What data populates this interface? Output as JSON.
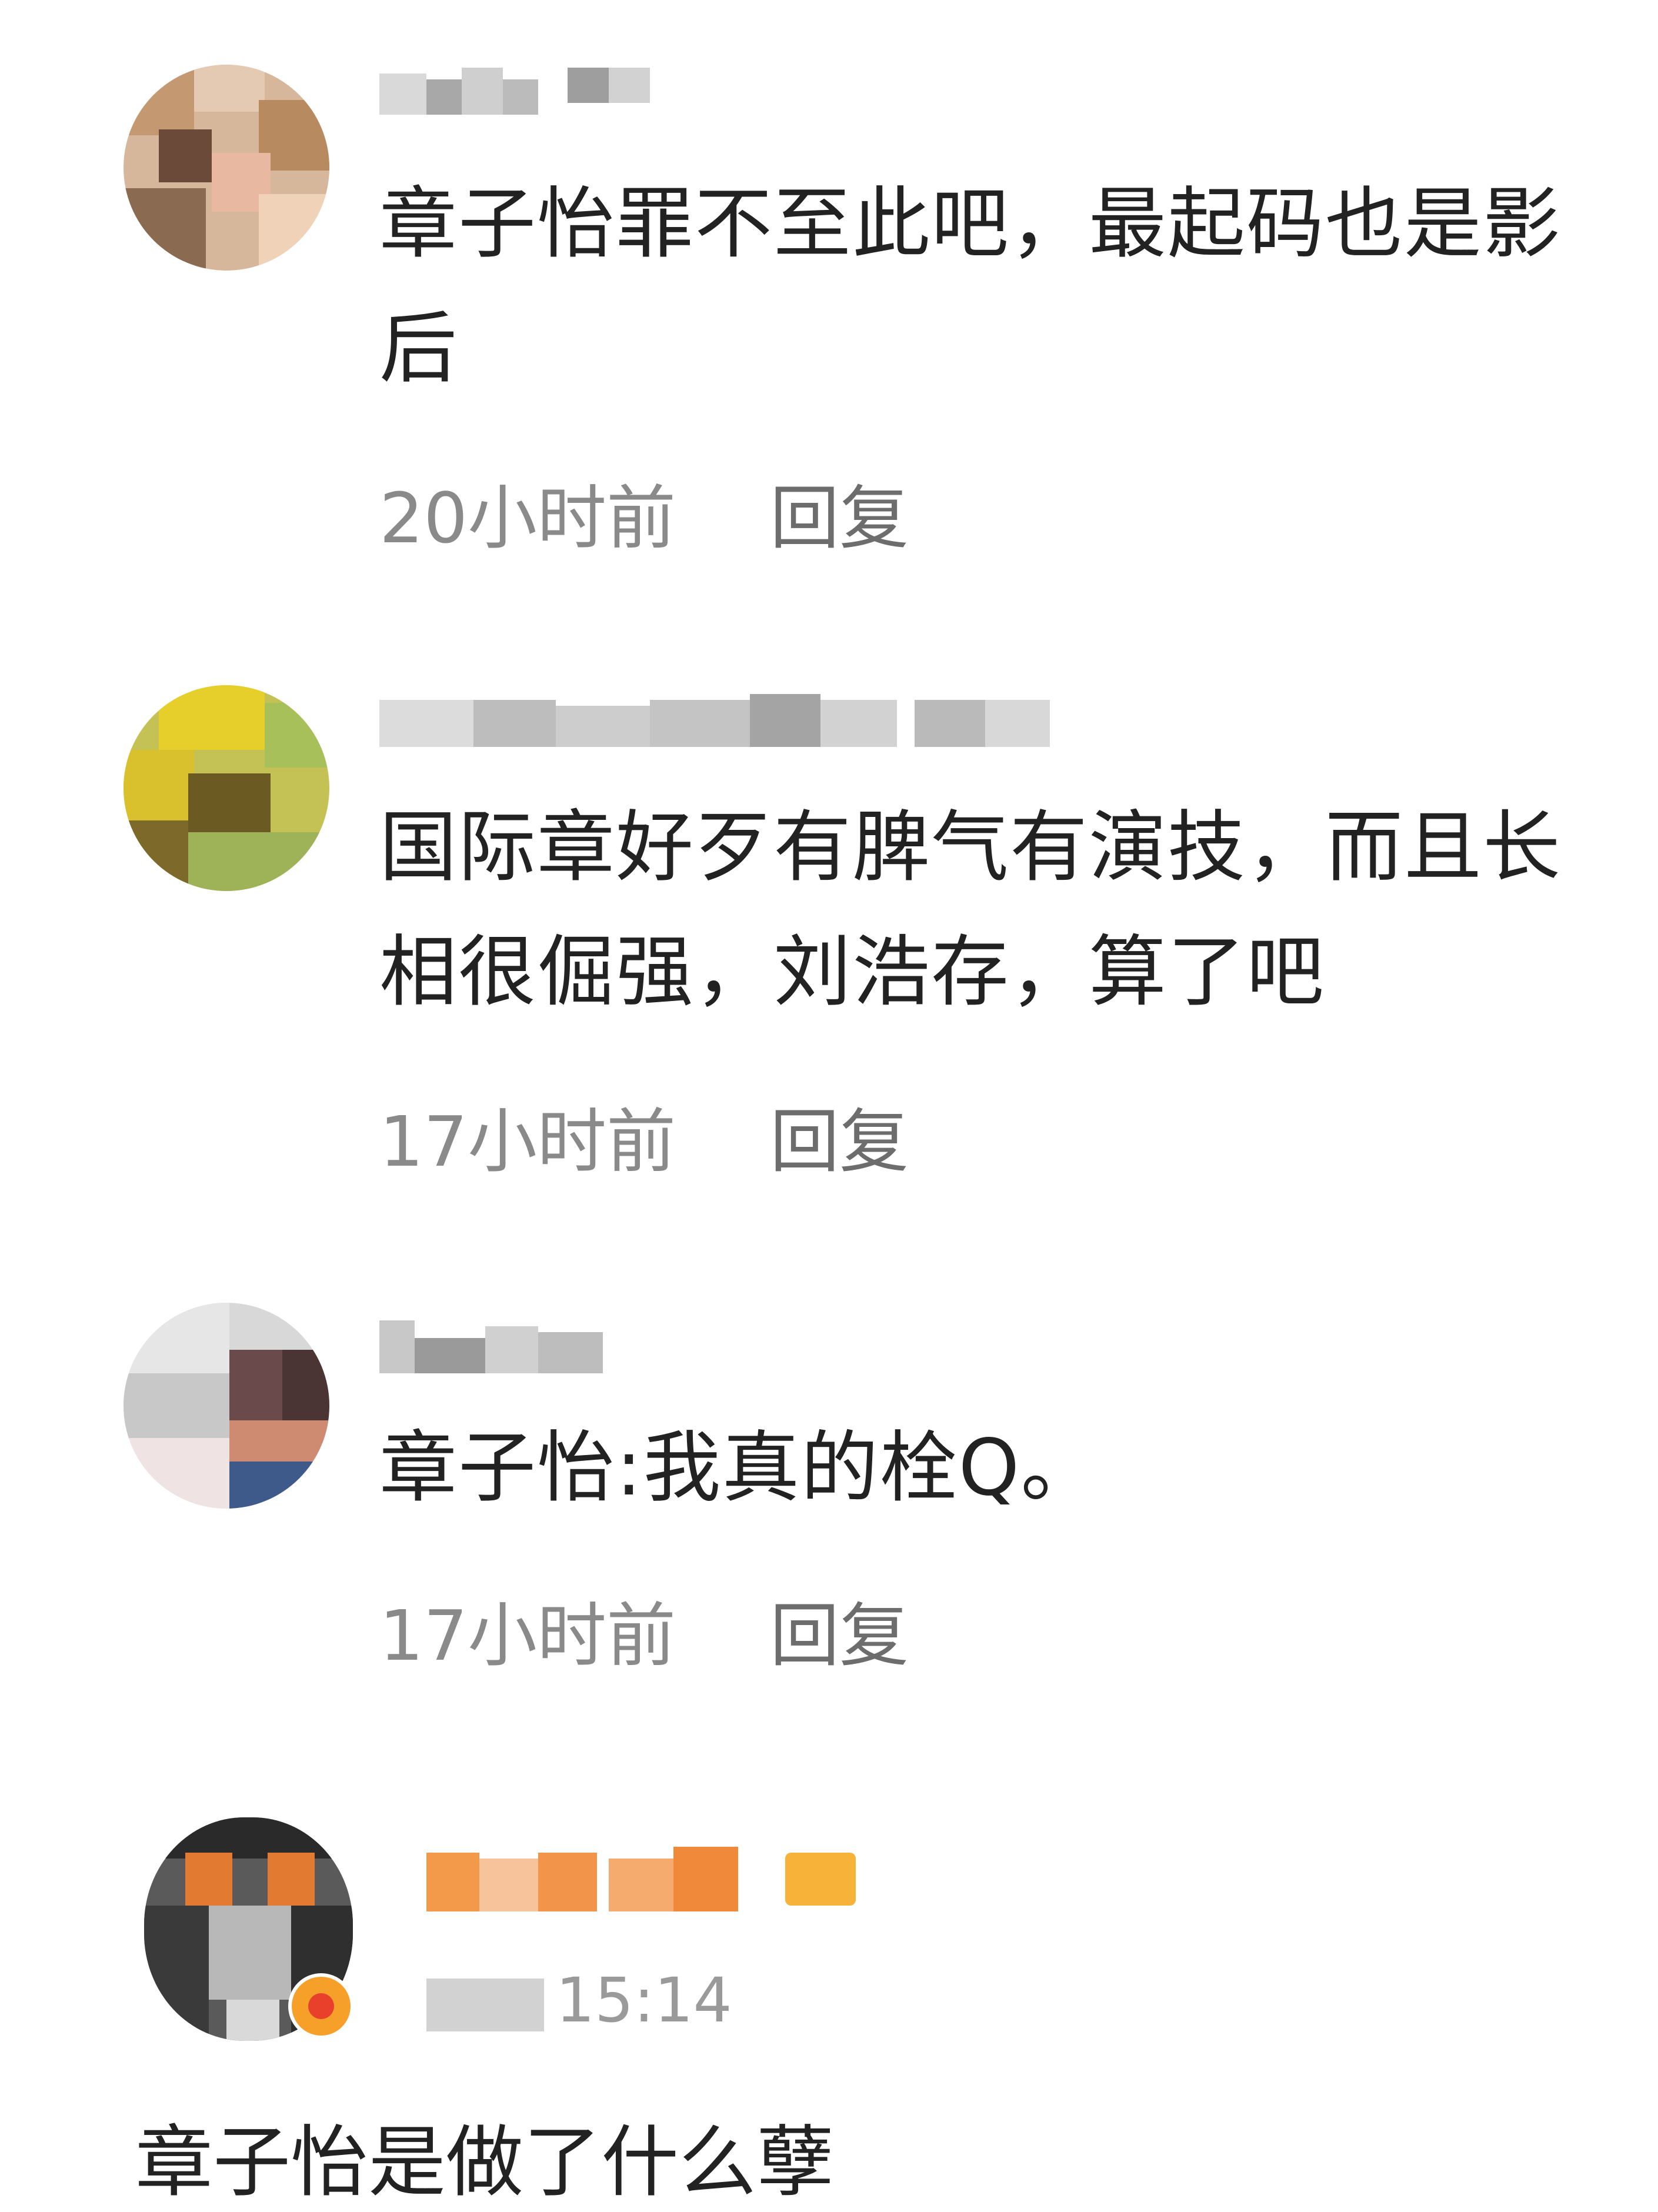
{
  "comments": [
    {
      "username": "",
      "text_line1": "章子怡罪不至此吧，最起码也是影",
      "text_line2": "后",
      "time": "20小时前",
      "reply_label": "回复"
    },
    {
      "username": "",
      "text_line1": "国际章好歹有脾气有演技，而且长",
      "text_line2": "相很倔强，刘浩存，算了吧",
      "time": "17小时前",
      "reply_label": "回复"
    },
    {
      "username": "",
      "text_line1": "章子怡:我真的栓Q。",
      "time": "17小时前",
      "reply_label": "回复"
    }
  ],
  "weibo_post": {
    "username": "",
    "time": "15:14",
    "text": "章子怡是做了什么孽"
  },
  "colors": {
    "text": "#222222",
    "meta": "#8a8a8a",
    "reply": "#6d6d6d",
    "vip_name": "#f39a4a"
  },
  "icons": {
    "avatar": "blurred-avatar",
    "vip_badge": "crown-icon",
    "verified_badge": "verified-icon"
  }
}
